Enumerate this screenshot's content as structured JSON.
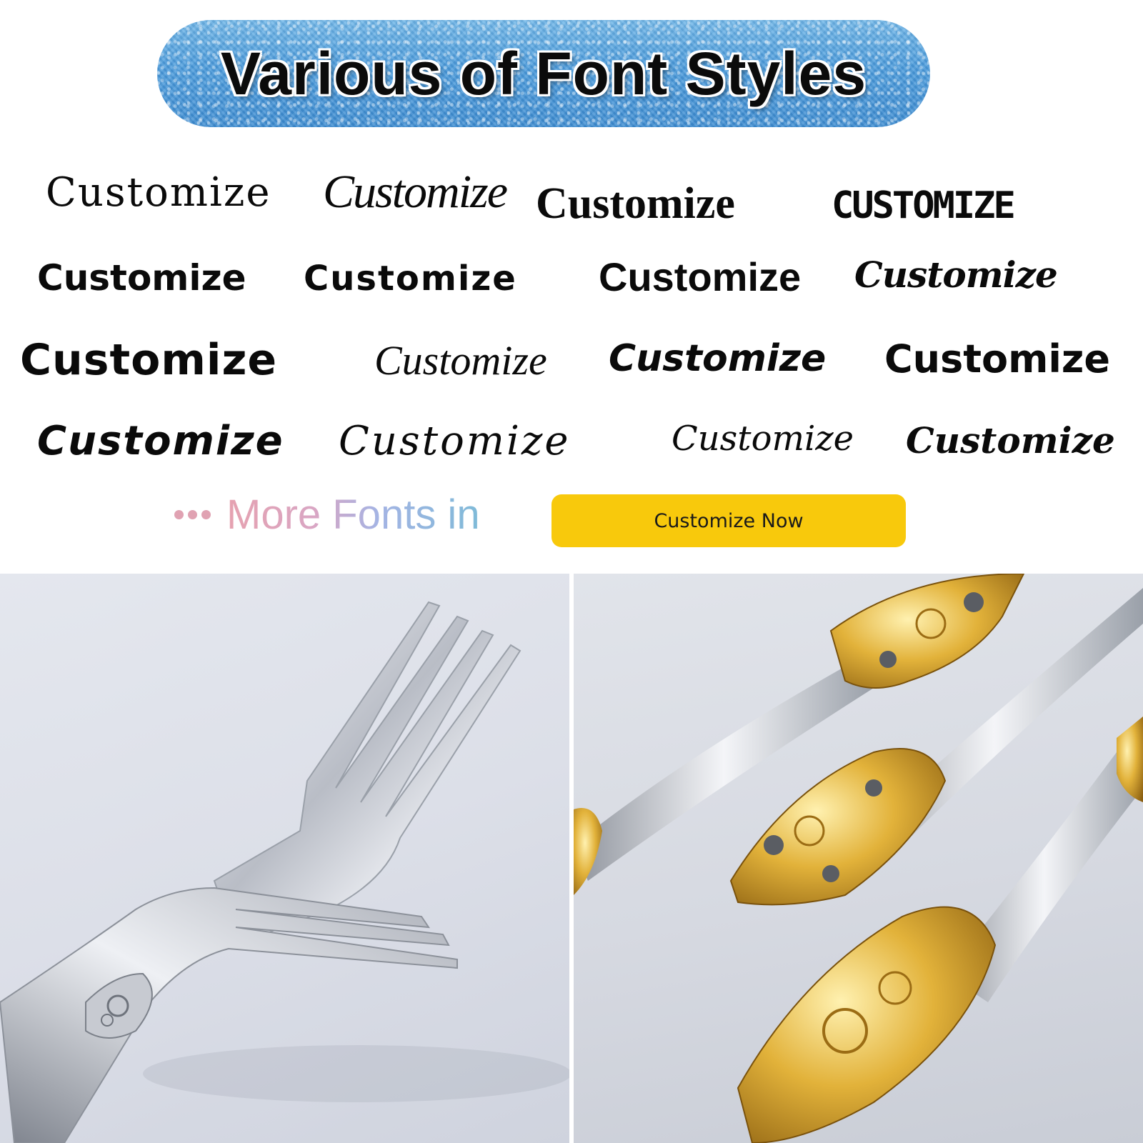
{
  "banner": {
    "title": "Various of Font Styles"
  },
  "samples": {
    "r1c1": "Customize",
    "r1c2": "Customize",
    "r1c3": "Customize",
    "r1c4": "CUSTOMIZE",
    "r2c1": "Customize",
    "r2c2": "Customize",
    "r2c3": "Customize",
    "r2c4": "Customize",
    "r3c1": "Customize",
    "r3c2": "Customize",
    "r3c3": "Customize",
    "r3c4": "Customize",
    "r4c1": "Customize",
    "r4c2": "Customize",
    "r4c3": "Customize",
    "r4c4": "Customize"
  },
  "more": {
    "text": "More Fonts in",
    "button_label": "Customize Now"
  },
  "colors": {
    "button": "#f8c90c",
    "banner": "#4a9bdc",
    "gold": "#d9a62a",
    "silver": "#c9ccd3"
  }
}
